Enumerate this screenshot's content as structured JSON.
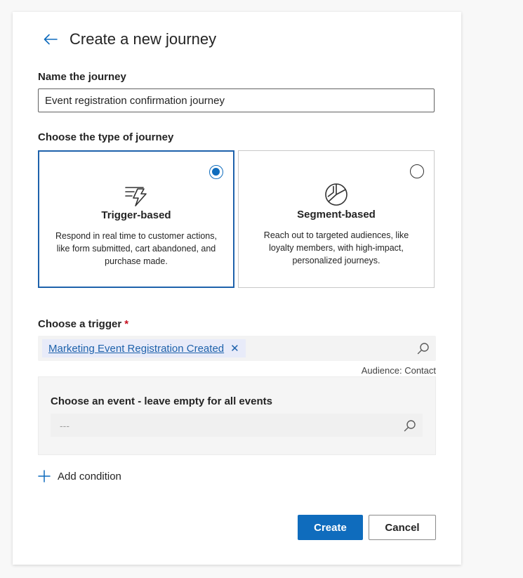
{
  "header": {
    "title": "Create a new journey"
  },
  "name_field": {
    "label": "Name the journey",
    "value": "Event registration confirmation journey"
  },
  "journey_type": {
    "label": "Choose the type of journey",
    "options": [
      {
        "title": "Trigger-based",
        "description": "Respond in real time to customer actions, like form submitted, cart abandoned, and purchase made.",
        "selected": true,
        "icon": "trigger-lightning-icon"
      },
      {
        "title": "Segment-based",
        "description": "Reach out to targeted audiences, like loyalty members, with high-impact, personalized journeys.",
        "selected": false,
        "icon": "pie-chart-icon"
      }
    ]
  },
  "trigger": {
    "label": "Choose a trigger",
    "required_mark": "*",
    "selected_tag": "Marketing Event Registration Created",
    "remove_glyph": "✕",
    "audience": "Audience: Contact"
  },
  "event": {
    "label": "Choose an event - leave empty for all events",
    "placeholder": "---"
  },
  "add_condition": {
    "label": "Add condition"
  },
  "actions": {
    "create_label": "Create",
    "cancel_label": "Cancel"
  },
  "colors": {
    "accent": "#0f6cbd",
    "selected_border": "#1e62ab",
    "link": "#1e62ab",
    "required": "#c50f1f"
  }
}
